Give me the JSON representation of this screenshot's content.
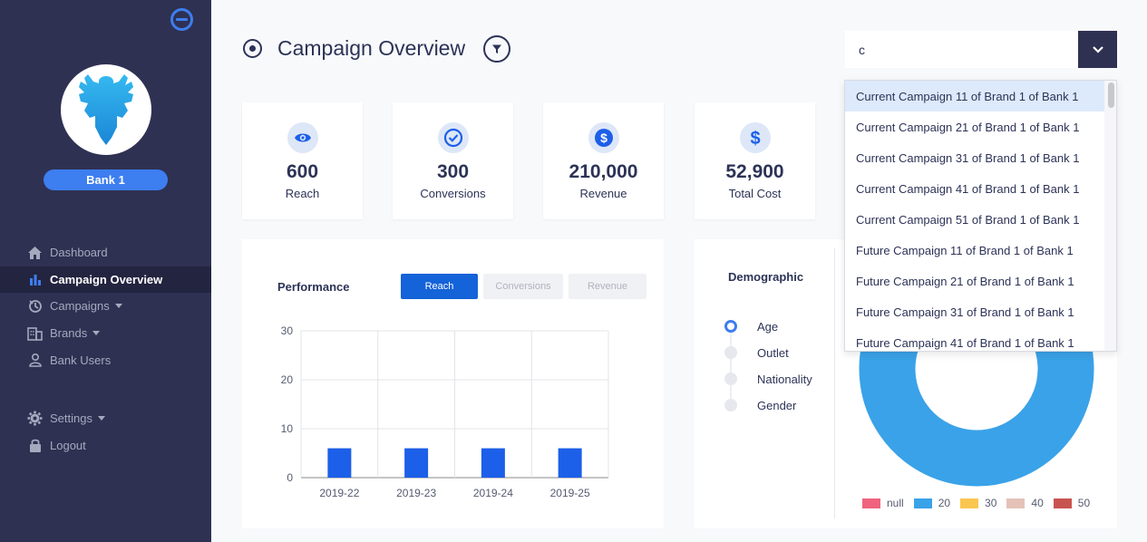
{
  "sidebar": {
    "bank_name": "Bank 1",
    "nav": [
      {
        "label": "Dashboard",
        "icon": "home-icon"
      },
      {
        "label": "Campaign Overview",
        "icon": "bar-chart-icon",
        "active": true
      },
      {
        "label": "Campaigns",
        "icon": "campaigns-icon",
        "has_caret": true
      },
      {
        "label": "Brands",
        "icon": "building-icon",
        "has_caret": true
      },
      {
        "label": "Bank Users",
        "icon": "user-icon"
      }
    ],
    "nav_bottom": [
      {
        "label": "Settings",
        "icon": "gear-icon",
        "has_caret": true
      },
      {
        "label": "Logout",
        "icon": "lock-icon"
      }
    ]
  },
  "header": {
    "title": "Campaign Overview"
  },
  "campaign_select": {
    "value": "c",
    "options": [
      "Current Campaign 11 of Brand 1 of Bank 1",
      "Current Campaign 21 of Brand 1 of Bank 1",
      "Current Campaign 31 of Brand 1 of Bank 1",
      "Current Campaign 41 of Brand 1 of Bank 1",
      "Current Campaign 51 of Brand 1 of Bank 1",
      "Future Campaign 11 of Brand 1 of Bank 1",
      "Future Campaign 21 of Brand 1 of Bank 1",
      "Future Campaign 31 of Brand 1 of Bank 1",
      "Future Campaign 41 of Brand 1 of Bank 1"
    ],
    "highlighted_index": 0
  },
  "kpis": [
    {
      "value": "600",
      "label": "Reach",
      "icon": "eye-icon"
    },
    {
      "value": "300",
      "label": "Conversions",
      "icon": "check-circle-icon"
    },
    {
      "value": "210,000",
      "label": "Revenue",
      "icon": "dollar-icon"
    },
    {
      "value": "52,900",
      "label": "Total Cost",
      "icon": "dollar-icon"
    }
  ],
  "performance": {
    "title": "Performance",
    "tabs": [
      "Reach",
      "Conversions",
      "Revenue"
    ],
    "active_tab": "Reach"
  },
  "demographic": {
    "title": "Demographic",
    "options": [
      "Age",
      "Outlet",
      "Nationality",
      "Gender"
    ],
    "selected": "Age"
  },
  "chart_data": [
    {
      "type": "bar",
      "title": "",
      "categories": [
        "2019-22",
        "2019-23",
        "2019-24",
        "2019-25"
      ],
      "values": [
        6,
        6,
        6,
        6
      ],
      "ylim": [
        0,
        30
      ],
      "yticks": [
        0,
        10,
        20,
        30
      ],
      "grid": true,
      "color": "#1c5fe8"
    },
    {
      "type": "pie",
      "donut": true,
      "labels": [
        "null",
        "20",
        "30",
        "40",
        "50"
      ],
      "colors": [
        "#f0637e",
        "#3aa2e8",
        "#fbc64f",
        "#e5c2b8",
        "#c85450"
      ],
      "values": [
        6,
        84,
        5,
        2,
        3
      ]
    }
  ]
}
